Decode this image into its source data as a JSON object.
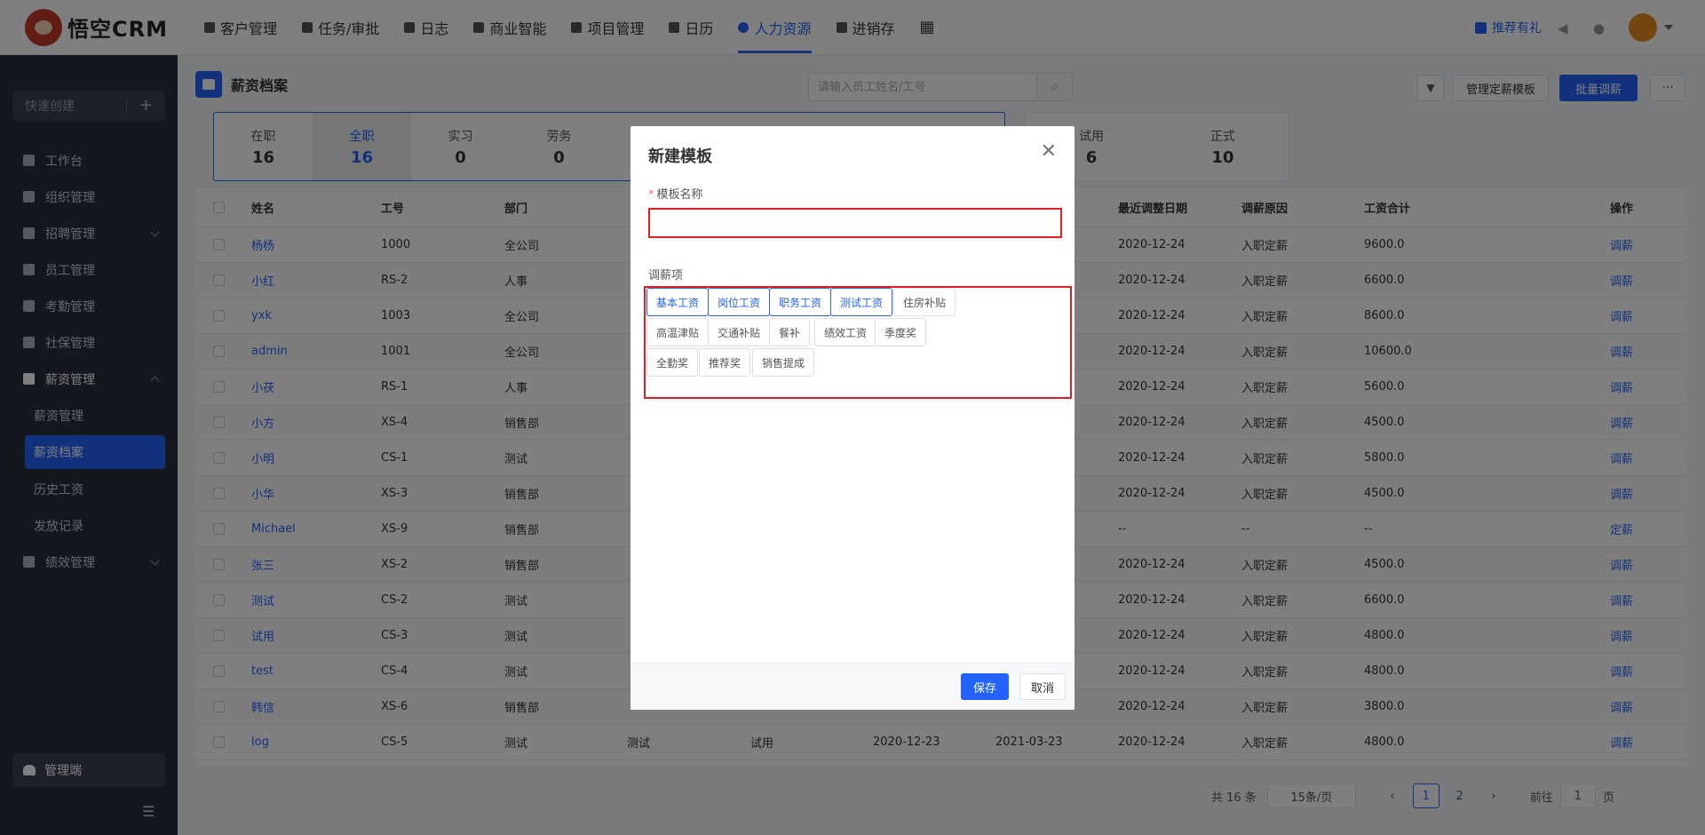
{
  "app": {
    "title": "悟空CRM"
  },
  "nav": [
    {
      "label": "客户管理",
      "icon": "customer-icon",
      "active": false
    },
    {
      "label": "任务/审批",
      "icon": "task-icon",
      "active": false
    },
    {
      "label": "日志",
      "icon": "log-icon",
      "active": false
    },
    {
      "label": "商业智能",
      "icon": "bi-icon",
      "active": false
    },
    {
      "label": "项目管理",
      "icon": "project-icon",
      "active": false
    },
    {
      "label": "日历",
      "icon": "calendar-icon",
      "active": false
    },
    {
      "label": "人力资源",
      "icon": "hr-icon",
      "active": true
    },
    {
      "label": "进销存",
      "icon": "inventory-icon",
      "active": false
    }
  ],
  "topright": {
    "gift": "推荐有礼"
  },
  "sidebar": {
    "quick_create": "快速创建",
    "items": [
      {
        "label": "工作台",
        "icon": "desk-icon"
      },
      {
        "label": "组织管理",
        "icon": "org-icon"
      },
      {
        "label": "招聘管理",
        "icon": "recruit-icon",
        "arrow": "down"
      },
      {
        "label": "员工管理",
        "icon": "employee-icon"
      },
      {
        "label": "考勤管理",
        "icon": "attendance-icon"
      },
      {
        "label": "社保管理",
        "icon": "insurance-icon"
      },
      {
        "label": "薪资管理",
        "icon": "salary-icon",
        "arrow": "up",
        "open": true
      }
    ],
    "sub_items": [
      {
        "label": "薪资管理",
        "active": false
      },
      {
        "label": "薪资档案",
        "active": true
      },
      {
        "label": "历史工资",
        "active": false
      },
      {
        "label": "发放记录",
        "active": false
      }
    ],
    "after": [
      {
        "label": "绩效管理",
        "icon": "performance-icon",
        "arrow": "down"
      }
    ],
    "admin": "管理端"
  },
  "page": {
    "title": "薪资档案",
    "search_placeholder": "请输入员工姓名/工号",
    "manage_template": "管理定薪模板",
    "batch_adjust": "批量调薪",
    "more": "···"
  },
  "stats": [
    {
      "label": "在职",
      "value": "16",
      "active": false
    },
    {
      "label": "全职",
      "value": "16",
      "active": true
    },
    {
      "label": "实习",
      "value": "0",
      "active": false
    },
    {
      "label": "劳务",
      "value": "0",
      "active": false
    }
  ],
  "stats2": [
    {
      "label": "试用",
      "value": "6"
    },
    {
      "label": "正式",
      "value": "10"
    }
  ],
  "table": {
    "headers": {
      "name": "姓名",
      "no": "工号",
      "dept": "部门",
      "adj_date": "最近调整日期",
      "reason": "调薪原因",
      "total": "工资合计",
      "op": "操作"
    },
    "rows": [
      {
        "name": "杨杨",
        "no": "1000",
        "dept": "全公司",
        "pos": "",
        "type": "",
        "d1": "",
        "d2": "",
        "adj": "2020-12-24",
        "reason": "入职定薪",
        "total": "9600.0",
        "op": "调薪"
      },
      {
        "name": "小红",
        "no": "RS-2",
        "dept": "人事",
        "pos": "",
        "type": "",
        "d1": "",
        "d2": "",
        "adj": "2020-12-24",
        "reason": "入职定薪",
        "total": "6600.0",
        "op": "调薪"
      },
      {
        "name": "yxk",
        "no": "1003",
        "dept": "全公司",
        "pos": "",
        "type": "",
        "d1": "",
        "d2": "",
        "adj": "2020-12-24",
        "reason": "入职定薪",
        "total": "8600.0",
        "op": "调薪"
      },
      {
        "name": "admin",
        "no": "1001",
        "dept": "全公司",
        "pos": "",
        "type": "",
        "d1": "",
        "d2": "",
        "adj": "2020-12-24",
        "reason": "入职定薪",
        "total": "10600.0",
        "op": "调薪"
      },
      {
        "name": "小茯",
        "no": "RS-1",
        "dept": "人事",
        "pos": "",
        "type": "",
        "d1": "",
        "d2": "",
        "adj": "2020-12-24",
        "reason": "入职定薪",
        "total": "5600.0",
        "op": "调薪"
      },
      {
        "name": "小方",
        "no": "XS-4",
        "dept": "销售部",
        "pos": "",
        "type": "",
        "d1": "",
        "d2": "",
        "adj": "2020-12-24",
        "reason": "入职定薪",
        "total": "4500.0",
        "op": "调薪"
      },
      {
        "name": "小明",
        "no": "CS-1",
        "dept": "测试",
        "pos": "",
        "type": "",
        "d1": "",
        "d2": "",
        "adj": "2020-12-24",
        "reason": "入职定薪",
        "total": "5800.0",
        "op": "调薪"
      },
      {
        "name": "小华",
        "no": "XS-3",
        "dept": "销售部",
        "pos": "",
        "type": "",
        "d1": "",
        "d2": "",
        "adj": "2020-12-24",
        "reason": "入职定薪",
        "total": "4500.0",
        "op": "调薪"
      },
      {
        "name": "Michael",
        "no": "XS-9",
        "dept": "销售部",
        "pos": "",
        "type": "",
        "d1": "",
        "d2": "",
        "adj": "--",
        "reason": "--",
        "total": "--",
        "op": "定薪"
      },
      {
        "name": "张三",
        "no": "XS-2",
        "dept": "销售部",
        "pos": "",
        "type": "",
        "d1": "",
        "d2": "",
        "adj": "2020-12-24",
        "reason": "入职定薪",
        "total": "4500.0",
        "op": "调薪"
      },
      {
        "name": "测试",
        "no": "CS-2",
        "dept": "测试",
        "pos": "",
        "type": "",
        "d1": "",
        "d2": "",
        "adj": "2020-12-24",
        "reason": "入职定薪",
        "total": "6600.0",
        "op": "调薪"
      },
      {
        "name": "试用",
        "no": "CS-3",
        "dept": "测试",
        "pos": "",
        "type": "",
        "d1": "",
        "d2": "",
        "adj": "2020-12-24",
        "reason": "入职定薪",
        "total": "4800.0",
        "op": "调薪"
      },
      {
        "name": "test",
        "no": "CS-4",
        "dept": "测试",
        "pos": "",
        "type": "",
        "d1": "",
        "d2": "",
        "adj": "2020-12-24",
        "reason": "入职定薪",
        "total": "4800.0",
        "op": "调薪"
      },
      {
        "name": "韩信",
        "no": "XS-6",
        "dept": "销售部",
        "pos": "",
        "type": "",
        "d1": "",
        "d2": "",
        "adj": "2020-12-24",
        "reason": "入职定薪",
        "total": "3800.0",
        "op": "调薪"
      },
      {
        "name": "log",
        "no": "CS-5",
        "dept": "测试",
        "pos": "测试",
        "type": "试用",
        "d1": "2020-12-23",
        "d2": "2021-03-23",
        "adj": "2020-12-24",
        "reason": "入职定薪",
        "total": "4800.0",
        "op": "调薪"
      }
    ]
  },
  "pager": {
    "total": "共 16 条",
    "size": "15条/页",
    "pages": [
      "1",
      "2"
    ],
    "goto": "前往",
    "goto_value": "1",
    "page_unit": "页"
  },
  "modal": {
    "title": "新建模板",
    "name_label": "模板名称",
    "name_value": "",
    "items_label": "调薪项",
    "tags": [
      {
        "label": "基本工资",
        "selected": true
      },
      {
        "label": "岗位工资",
        "selected": true
      },
      {
        "label": "职务工资",
        "selected": true
      },
      {
        "label": "测试工资",
        "selected": true
      },
      {
        "label": "住房补贴",
        "selected": false
      },
      {
        "label": "高温津贴",
        "selected": false
      },
      {
        "label": "交通补贴",
        "selected": false
      },
      {
        "label": "餐补",
        "selected": false
      },
      {
        "label": "绩效工资",
        "selected": false
      },
      {
        "label": "季度奖",
        "selected": false
      },
      {
        "label": "全勤奖",
        "selected": false
      },
      {
        "label": "推荐奖",
        "selected": false
      },
      {
        "label": "销售提成",
        "selected": false
      }
    ],
    "save": "保存",
    "cancel": "取消"
  },
  "colors": {
    "primary": "#2362fb",
    "sidebar": "#2a2f3e",
    "highlight": "#e02020"
  }
}
